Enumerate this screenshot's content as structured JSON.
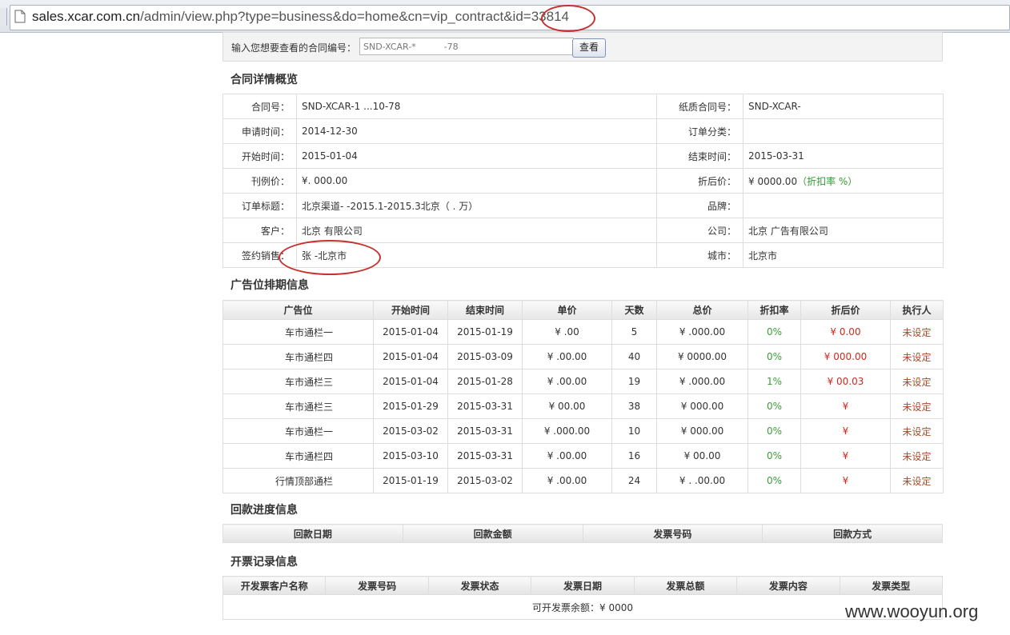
{
  "browser": {
    "url_host": "sales.xcar.com.cn",
    "url_path": "/admin/view.php?type=business&do=home&cn=vip_contract&id",
    "url_id": "=33814"
  },
  "search": {
    "label": "输入您想要查看的合同编号：",
    "value": "SND-XCAR-*          -78",
    "button": "查看"
  },
  "overview": {
    "title": "合同详情概览",
    "rows": [
      {
        "k1": "合同号：",
        "v1": "SND-XCAR-1   ...10-78",
        "k2": "纸质合同号：",
        "v2": "SND-XCAR-"
      },
      {
        "k1": "申请时间：",
        "v1": "2014-12-30",
        "k2": "订单分类：",
        "v2": ""
      },
      {
        "k1": "开始时间：",
        "v1": "2015-01-04",
        "k2": "结束时间：",
        "v2": "2015-03-31"
      },
      {
        "k1": "刊例价：",
        "v1": "¥.      000.00",
        "k2": "折后价：",
        "v2": "¥      0000.00",
        "v2_note": "（折扣率      %）"
      },
      {
        "k1": "订单标题：",
        "v1": "北京渠道-                                    -2015.1-2015.3北京（ .  万）",
        "k2": "品牌：",
        "v2": ""
      },
      {
        "k1": "客户：",
        "v1": "北京                  有限公司",
        "k2": "公司：",
        "v2": "北京              广告有限公司"
      },
      {
        "k1": "签约销售：",
        "v1": "张    -北京市",
        "k2": "城市：",
        "v2": "北京市"
      }
    ]
  },
  "ads": {
    "title": "广告位排期信息",
    "headers": [
      "广告位",
      "开始时间",
      "结束时间",
      "单价",
      "天数",
      "总价",
      "折扣率",
      "折后价",
      "执行人"
    ],
    "rows": [
      {
        "pos": "车市通栏一",
        "start": "2015-01-04",
        "end": "2015-01-19",
        "unit": "¥     .00",
        "days": "5",
        "total": "¥     .000.00",
        "rate": "0%",
        "final": "¥          0.00",
        "exec": "未设定"
      },
      {
        "pos": "车市通栏四",
        "start": "2015-01-04",
        "end": "2015-03-09",
        "unit": "¥    .00.00",
        "days": "40",
        "total": "¥     0000.00",
        "rate": "0%",
        "final": "¥      000.00",
        "exec": "未设定"
      },
      {
        "pos": "车市通栏三",
        "start": "2015-01-04",
        "end": "2015-01-28",
        "unit": "¥    .00.00",
        "days": "19",
        "total": "¥     .000.00",
        "rate": "1%",
        "final": "¥        00.03",
        "exec": "未设定"
      },
      {
        "pos": "车市通栏三",
        "start": "2015-01-29",
        "end": "2015-03-31",
        "unit": "¥     00.00",
        "days": "38",
        "total": "¥      000.00",
        "rate": "0%",
        "final": "¥",
        "exec": "未设定"
      },
      {
        "pos": "车市通栏一",
        "start": "2015-03-02",
        "end": "2015-03-31",
        "unit": "¥   .000.00",
        "days": "10",
        "total": "¥      000.00",
        "rate": "0%",
        "final": "¥",
        "exec": "未设定"
      },
      {
        "pos": "车市通栏四",
        "start": "2015-03-10",
        "end": "2015-03-31",
        "unit": "¥    .00.00",
        "days": "16",
        "total": "¥      00.00",
        "rate": "0%",
        "final": "¥",
        "exec": "未设定"
      },
      {
        "pos": "行情顶部通栏",
        "start": "2015-01-19",
        "end": "2015-03-02",
        "unit": "¥    .00.00",
        "days": "24",
        "total": "¥     .  .00.00",
        "rate": "0%",
        "final": "¥",
        "exec": "未设定"
      }
    ]
  },
  "payment": {
    "title": "回款进度信息",
    "headers": [
      "回款日期",
      "回款金额",
      "发票号码",
      "回款方式"
    ]
  },
  "invoice": {
    "title": "开票记录信息",
    "headers": [
      "开发票客户名称",
      "发票号码",
      "发票状态",
      "发票日期",
      "发票总额",
      "发票内容",
      "发票类型"
    ],
    "balance": "可开发票余额：¥     0000"
  },
  "watermark": "www.wooyun.org",
  "colors": {
    "accent_red": "#cc2a1e",
    "discount_green": "#3a9d3a",
    "circle": "#c8302d"
  }
}
